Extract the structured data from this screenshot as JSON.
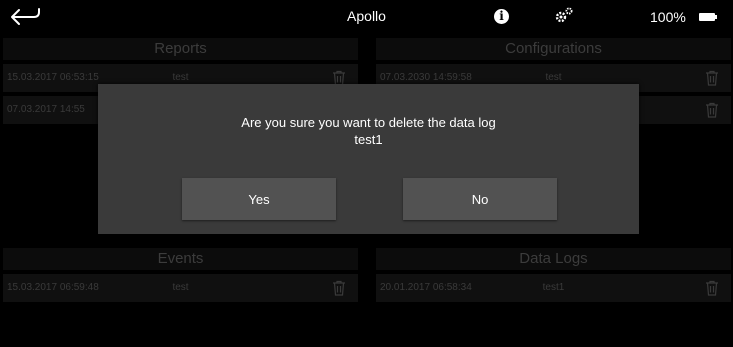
{
  "header": {
    "title": "Apollo",
    "battery_text": "100%",
    "info_glyph": "i"
  },
  "panels": {
    "reports": {
      "title": "Reports",
      "rows": [
        {
          "date": "15.03.2017 06:53:15",
          "name": "test"
        },
        {
          "date": "07.03.2017 14:55",
          "name": ""
        }
      ]
    },
    "configurations": {
      "title": "Configurations",
      "rows": [
        {
          "date": "07.03.2030 14:59:58",
          "name": "test"
        },
        {
          "date": "",
          "name": ""
        }
      ]
    },
    "events": {
      "title": "Events",
      "rows": [
        {
          "date": "15.03.2017 06:59:48",
          "name": "test"
        }
      ]
    },
    "data_logs": {
      "title": "Data Logs",
      "rows": [
        {
          "date": "20.01.2017 06:58:34",
          "name": "test1"
        }
      ]
    }
  },
  "dialog": {
    "message_line1": "Are you sure you want to delete the data log",
    "message_line2": "test1",
    "yes_label": "Yes",
    "no_label": "No"
  },
  "icons": {
    "back": "back-arrow-icon",
    "info": "info-icon",
    "settings": "gear-icon",
    "battery": "battery-icon",
    "delete": "trash-icon"
  }
}
